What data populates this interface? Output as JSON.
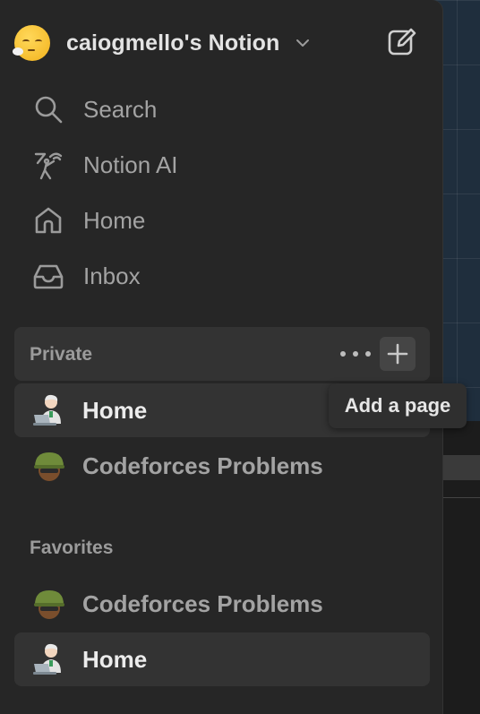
{
  "workspace": {
    "name": "caiogmello's Notion",
    "emoji": "face-exhaling-emoji"
  },
  "nav": [
    {
      "label": "Search",
      "icon": "search-icon"
    },
    {
      "label": "Notion AI",
      "icon": "notion-ai-icon"
    },
    {
      "label": "Home",
      "icon": "home-icon"
    },
    {
      "label": "Inbox",
      "icon": "inbox-icon"
    }
  ],
  "private": {
    "label": "Private",
    "pages": [
      {
        "label": "Home",
        "icon": "technologist-emoji"
      },
      {
        "label": "Codeforces Problems",
        "icon": "soldier-helmet-emoji"
      }
    ]
  },
  "favorites": {
    "label": "Favorites",
    "pages": [
      {
        "label": "Codeforces Problems",
        "icon": "soldier-helmet-emoji"
      },
      {
        "label": "Home",
        "icon": "technologist-emoji"
      }
    ]
  },
  "tooltip": {
    "text": "Add a page"
  },
  "colors": {
    "sidebar_bg": "#262626",
    "hover_bg": "#333333",
    "text_primary": "#ececec",
    "text_muted": "#a3a3a3"
  }
}
